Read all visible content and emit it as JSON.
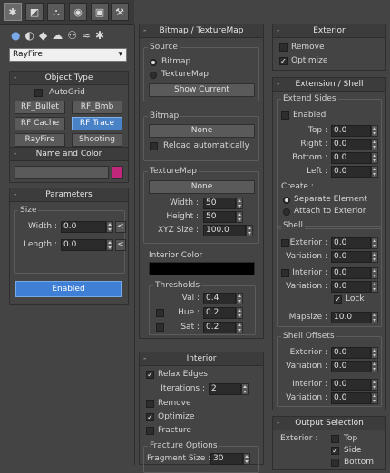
{
  "toolbar": {
    "tabs": [
      "✱",
      "◩",
      "⛬",
      "◉",
      "▣",
      "⚒"
    ],
    "icons": [
      "●",
      "◐",
      "◆",
      "☁",
      "⚇",
      "≈",
      "✱"
    ]
  },
  "left": {
    "dropdown": "RayFire",
    "object_type": {
      "title": "Object Type",
      "autogrid": "AutoGrid",
      "buttons": [
        "RF_Bullet",
        "RF_Bmb",
        "RF Cache",
        "RF Trace",
        "RayFire",
        "Shooting"
      ]
    },
    "name_color": {
      "title": "Name and Color",
      "swatch": "#c0267a"
    },
    "parameters": {
      "title": "Parameters",
      "size_label": "Size",
      "width_label": "Width :",
      "width_val": "0.0",
      "length_label": "Length :",
      "length_val": "0.0",
      "lt": "<",
      "enabled": "Enabled"
    }
  },
  "mid": {
    "bitmap_tex": {
      "title": "Bitmap / TextureMap",
      "source": "Source",
      "bitmap": "Bitmap",
      "texturemap": "TextureMap",
      "show_current": "Show Current",
      "bitmap_grp": "Bitmap",
      "none": "None",
      "reload": "Reload automatically",
      "texmap_grp": "TextureMap",
      "width_lbl": "Width :",
      "width_val": "50",
      "height_lbl": "Height :",
      "height_val": "50",
      "xyz_lbl": "XYZ Size :",
      "xyz_val": "100.0",
      "interior_color": "Interior Color",
      "thresholds": "Thresholds",
      "val_lbl": "Val :",
      "val_val": "0.4",
      "hue_lbl": "Hue :",
      "hue_val": "0.2",
      "sat_lbl": "Sat :",
      "sat_val": "0.2"
    },
    "interior": {
      "title": "Interior",
      "relax": "Relax Edges",
      "iter_lbl": "Iterations :",
      "iter_val": "2",
      "remove": "Remove",
      "optimize": "Optimize",
      "fracture": "Fracture",
      "fracture_opts": "Fracture Options",
      "frag_lbl": "Fragment Size :",
      "frag_val": "30"
    }
  },
  "right": {
    "exterior": {
      "title": "Exterior",
      "remove": "Remove",
      "optimize": "Optimize"
    },
    "ext_shell": {
      "title": "Extension / Shell",
      "extend_sides": "Extend Sides",
      "enabled": "Enabled",
      "top": "Top :",
      "right": "Right :",
      "bottom": "Bottom :",
      "left": "Left :",
      "zero": "0.0",
      "create": "Create :",
      "separate": "Separate Element",
      "attach": "Attach to Exterior",
      "shell": "Shell",
      "exterior_lbl": "Exterior :",
      "variation_lbl": "Variation :",
      "interior_lbl": "Interior :",
      "lock": "Lock",
      "mapsize_lbl": "Mapsize :",
      "mapsize_val": "10.0",
      "shell_offsets": "Shell Offsets"
    },
    "output": {
      "title": "Output Selection",
      "exterior_lbl": "Exterior :",
      "top": "Top",
      "side": "Side",
      "bottom": "Bottom"
    }
  }
}
